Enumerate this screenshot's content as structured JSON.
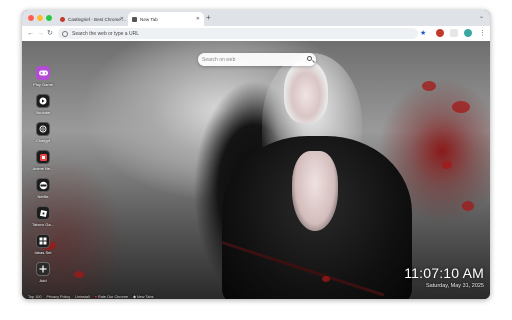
{
  "tabs": [
    {
      "label": "Castlegrief - Best Chrome ...",
      "active": false
    },
    {
      "label": "New Tab",
      "active": true
    }
  ],
  "toolbar": {
    "omnibox_placeholder": "Search the web or type a URL"
  },
  "search": {
    "placeholder": "Search on web"
  },
  "shortcuts": [
    {
      "label": "Play Game",
      "icon": "game-icon",
      "color": "#b44bd6"
    },
    {
      "label": "Youtube",
      "icon": "youtube-icon",
      "color": "#1c1c1c"
    },
    {
      "label": "Chatgpt",
      "icon": "chatgpt-icon",
      "color": "#1c1c1c"
    },
    {
      "label": "Anime Ne...",
      "icon": "anime-icon",
      "color": "#1c1c1c"
    },
    {
      "label": "Netflix",
      "icon": "netflix-icon",
      "color": "#1c1c1c"
    },
    {
      "label": "Tabcro Ga...",
      "icon": "roblox-icon",
      "color": "#1c1c1c"
    },
    {
      "label": "Ideas Set",
      "icon": "apps-icon",
      "color": "#1c1c1c"
    },
    {
      "label": "Add",
      "icon": "plus-icon",
      "color": "#2a2a2a"
    }
  ],
  "clock": {
    "time": "11:07:10 AM",
    "date": "Saturday, May 31, 2025"
  },
  "footer": {
    "links": [
      "Top 100",
      "Privacy Policy",
      "Uninstall",
      "Rate Our Chrome",
      "New Tabs"
    ]
  },
  "colors": {
    "accent": "#b44bd6",
    "blossom": "#a31818",
    "tab_active": "#ffffff",
    "tab_bar": "#dfe3e8"
  }
}
